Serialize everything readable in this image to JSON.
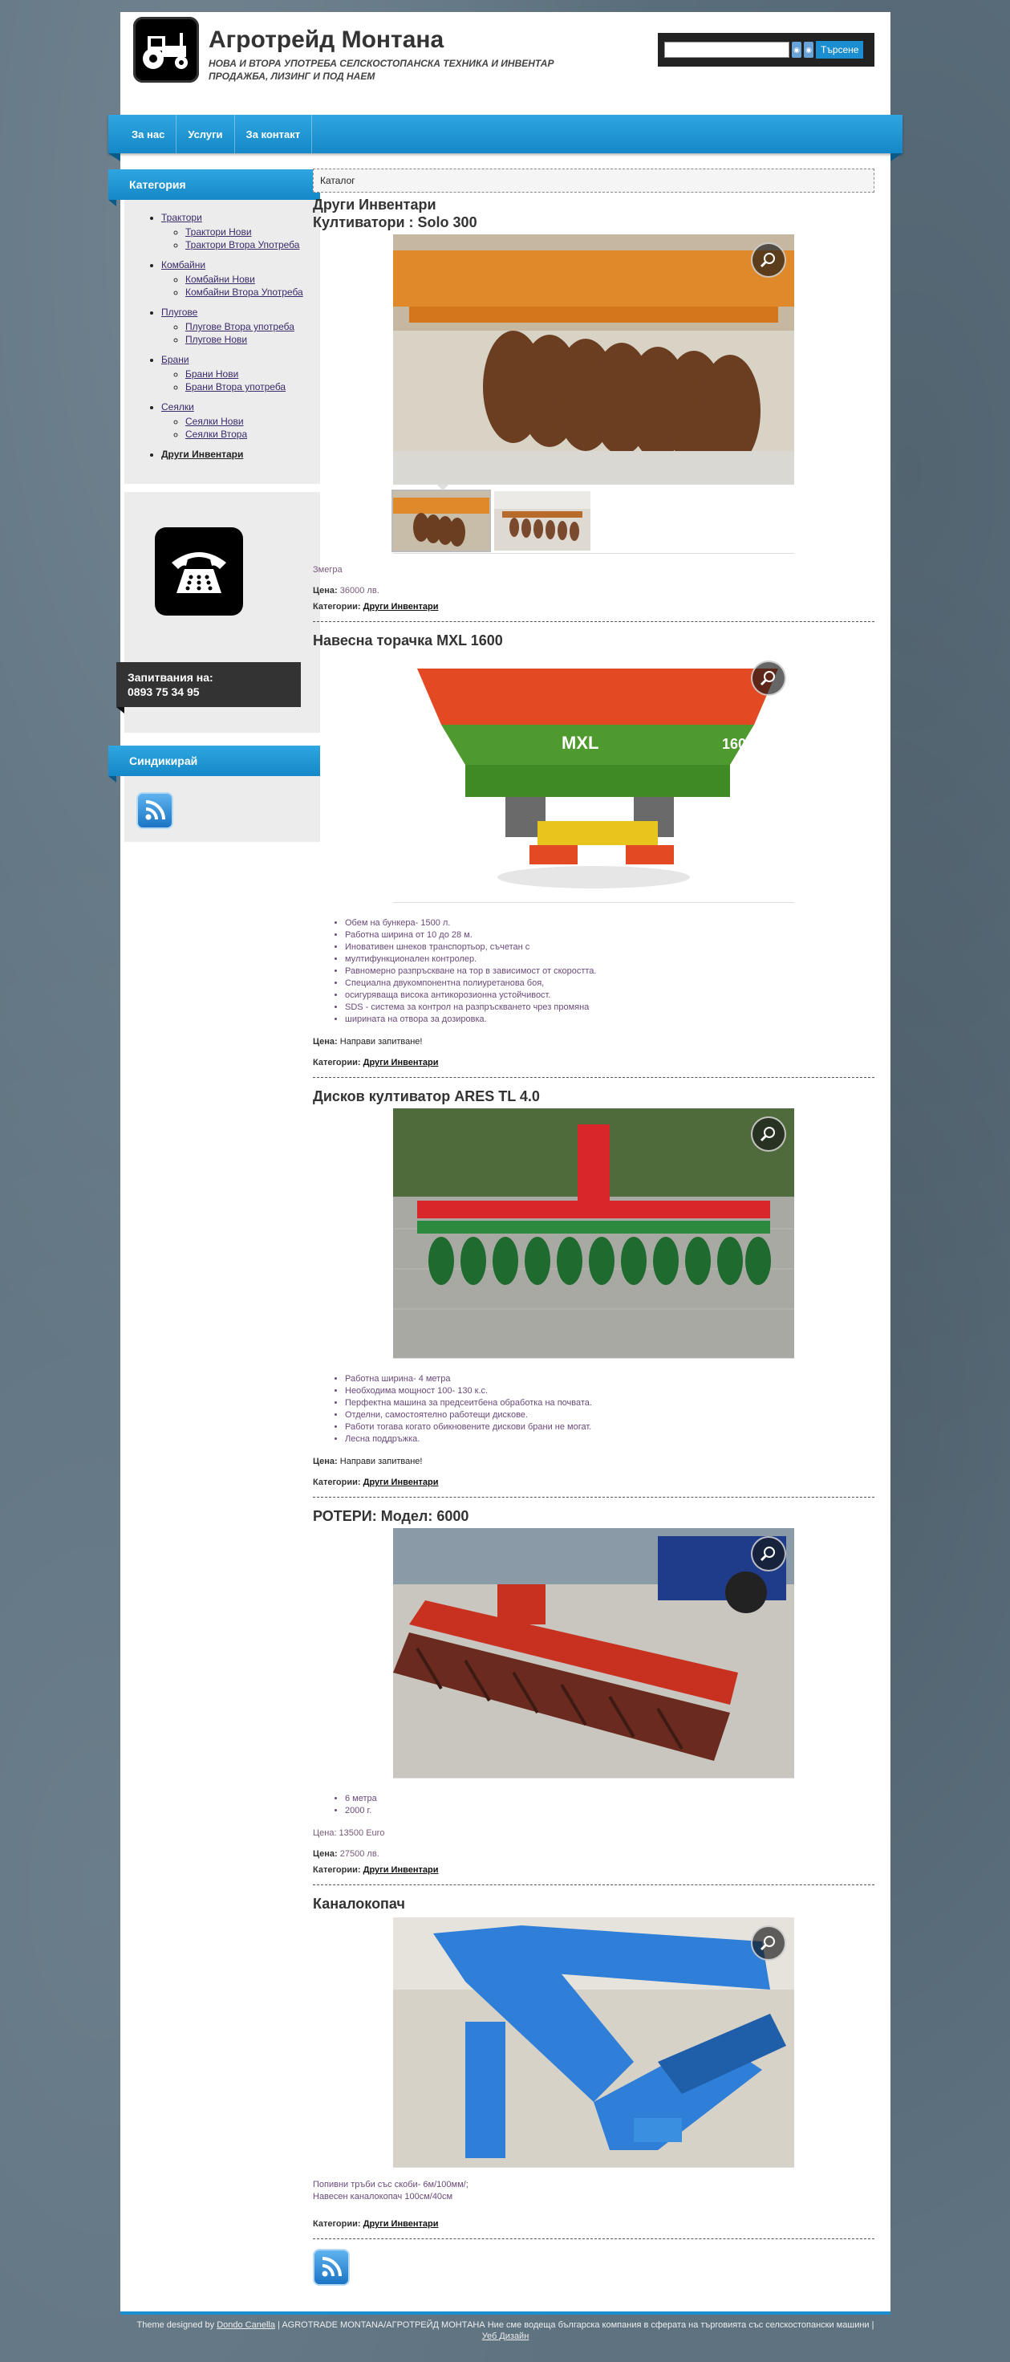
{
  "header": {
    "title": "Агротрейд Монтана",
    "description": "НОВА И ВТОРА УПОТРЕБА СЕЛСКОСТОПАНСКА ТЕХНИКА И ИНВЕНТАР ПРОДАЖБА, ЛИЗИНГ И ПОД НАЕМ",
    "logo_icon": "tractor-icon"
  },
  "search": {
    "placeholder": "",
    "button_label": "Търсене"
  },
  "nav": {
    "items": [
      {
        "label": "За нас"
      },
      {
        "label": "Услуги"
      },
      {
        "label": "За контакт"
      }
    ]
  },
  "sidebar": {
    "categories_title": "Категория",
    "categories": [
      {
        "label": "Трактори",
        "children": [
          {
            "label": "Трактори Нови"
          },
          {
            "label": "Трактори Втора Употреба"
          }
        ]
      },
      {
        "label": "Комбайни",
        "children": [
          {
            "label": "Комбайни Нови"
          },
          {
            "label": "Комбайни Втора Употреба"
          }
        ]
      },
      {
        "label": "Плугове",
        "children": [
          {
            "label": "Плугове Втора употреба"
          },
          {
            "label": "Плугове Нови"
          }
        ]
      },
      {
        "label": "Брани",
        "children": [
          {
            "label": "Брани Нови"
          },
          {
            "label": "Брани Втора употреба"
          }
        ]
      },
      {
        "label": "Сеялки",
        "children": [
          {
            "label": "Сеялки Нови"
          },
          {
            "label": "Сеялки Втора"
          }
        ]
      },
      {
        "label": "Други Инвентари",
        "children": []
      }
    ],
    "contact": {
      "heading": "Запитвания на:",
      "phone": "0893 75 34 95"
    },
    "syndicate_title": "Синдикирай"
  },
  "content": {
    "breadcrumb": "Каталог",
    "category_heading": "Други Инвентари",
    "labels": {
      "price": "Цена:",
      "categories": "Категории:"
    },
    "posts": [
      {
        "title": "Култиватори : Solo 300",
        "excerpt": "Змегра",
        "price": "36000 лв.",
        "category": "Други Инвентари"
      },
      {
        "title": "Навесна торачка MXL 1600",
        "features": [
          "Обем на бункера- 1500 л.",
          "Работна ширина от 10 до 28 м.",
          "Иновативен шнеков транспортьор, съчетан с",
          "мултифункционален контролер.",
          "Равномерно разпръскване на тор в зависимост от скоростта.",
          "Специална двукомпонентна полиуретанова боя,",
          "осигуряваща висока антикорозионна устойчивост.",
          "SDS - система за контрол на разпръскването чрез промяна",
          "ширината на отвора за дозировка."
        ],
        "price": "Направи запитване!",
        "category": "Други Инвентари"
      },
      {
        "title": "Дисков култиватор ARES TL 4.0",
        "features": [
          "Работна ширина- 4 метра",
          "Необходима мощност 100- 130 к.с.",
          "Перфектна машина за предсеитбена обработка на почвата.",
          "Отделни, самостоятелно работещи дискове.",
          "Работи тогава когато обикновените дискови брани не могат.",
          "Лесна поддръжка."
        ],
        "price": "Направи запитване!",
        "category": "Други Инвентари"
      },
      {
        "title": "РОТЕРИ: Модел: 6000",
        "features": [
          "6 метра",
          "2000 г."
        ],
        "extra": "Цена: 13500 Euro",
        "price": "27500 лв.",
        "category": "Други Инвентари"
      },
      {
        "title": "Каналокопач",
        "text_lines": [
          "Попивни тръби със скоби- 6м/100мм/;",
          "Навесен каналокопач 100см/40см"
        ],
        "category": "Други Инвентари"
      }
    ]
  },
  "footer": {
    "line1_prefix": "Theme designed by ",
    "designer": "Dondo Canella",
    "line1_suffix": " | AGROTRADE MONTANA/АГРОТРЕЙД МОНТАНА Ние сме водеща българска компания в сферата на търговията със селскостопански машини |",
    "line2": "Уеб Дизайн"
  },
  "colors": {
    "accent": "#1a8ed1",
    "page_bg": "#ffffff",
    "sidebar_bg": "#ececec"
  }
}
